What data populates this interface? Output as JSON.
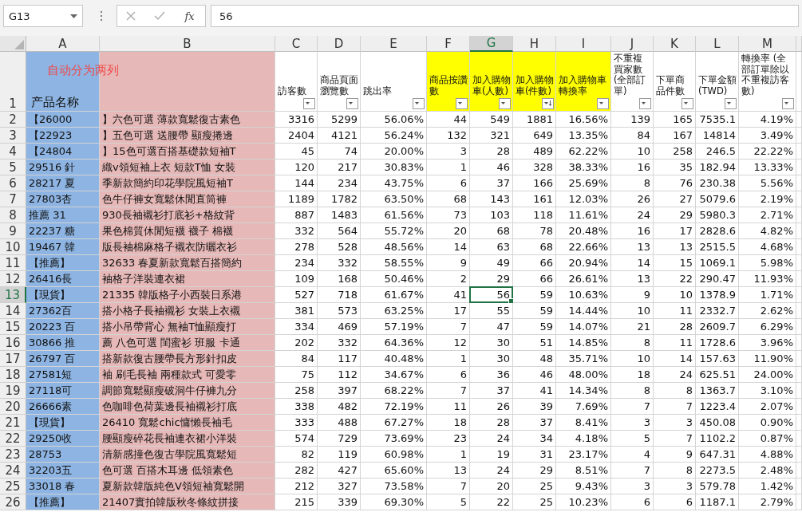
{
  "name_box": "G13",
  "formula_bar": {
    "function_label": "fx",
    "value": "56"
  },
  "header_row": "1",
  "columns": [
    {
      "letter": "A",
      "kind": "product",
      "selected": false,
      "color": "#8db4e2",
      "title": "产品名称",
      "note": "自动分为两列"
    },
    {
      "letter": "B",
      "kind": "product",
      "selected": false,
      "color": "#e6b8b7"
    },
    {
      "letter": "C",
      "kind": "metric",
      "selected": false,
      "title": "訪客數",
      "sorted": false
    },
    {
      "letter": "D",
      "kind": "metric",
      "selected": false,
      "title": "商品頁面瀏覽數",
      "sorted": false
    },
    {
      "letter": "E",
      "kind": "metric",
      "selected": false,
      "title": "跳出率",
      "sorted": false
    },
    {
      "letter": "F",
      "kind": "metric",
      "selected": false,
      "color": "#ffff00",
      "title": "商品按讚數",
      "sorted": false
    },
    {
      "letter": "G",
      "kind": "metric",
      "selected": true,
      "color": "#ffff00",
      "title": "加入購物車(人數)",
      "sorted": false
    },
    {
      "letter": "H",
      "kind": "metric",
      "selected": false,
      "color": "#ffff00",
      "title": "加入購物車(件數)",
      "sorted": true
    },
    {
      "letter": "I",
      "kind": "metric",
      "selected": false,
      "color": "#ffff00",
      "title": "加入購物車轉換率",
      "sorted": false
    },
    {
      "letter": "J",
      "kind": "metric",
      "selected": false,
      "title": "不重複買家數(全部訂單)",
      "sorted": false
    },
    {
      "letter": "K",
      "kind": "metric",
      "selected": false,
      "title": "下單商品件數",
      "sorted": false
    },
    {
      "letter": "L",
      "kind": "metric",
      "selected": false,
      "title": "下單金額(TWD)",
      "sorted": false
    },
    {
      "letter": "M",
      "kind": "metric",
      "selected": false,
      "title": "轉換率 (全部訂單除以不重複訪客數)",
      "sorted": false
    }
  ],
  "rows": [
    {
      "number": "2",
      "selected": false,
      "a": "【26000",
      "b": "】六色可選 薄款寬鬆復古素色",
      "values": [
        "3316",
        "5299",
        "56.06%",
        "44",
        "549",
        "1881",
        "16.56%",
        "139",
        "165",
        "7535.1",
        "4.19%"
      ]
    },
    {
      "number": "3",
      "selected": false,
      "a": "【22923",
      "b": "】五色可選 送腰帶 顯瘦捲邊",
      "values": [
        "2404",
        "4121",
        "56.24%",
        "132",
        "321",
        "649",
        "13.35%",
        "84",
        "167",
        "14814",
        "3.49%"
      ]
    },
    {
      "number": "4",
      "selected": false,
      "a": "【24804",
      "b": "】15色可選百搭基礎款短袖T",
      "values": [
        "45",
        "74",
        "20.00%",
        "3",
        "28",
        "489",
        "62.22%",
        "10",
        "258",
        "246.5",
        "22.22%"
      ]
    },
    {
      "number": "5",
      "selected": false,
      "a": "29516 針",
      "b": "織v領短袖上衣 短款T恤 女裝",
      "values": [
        "120",
        "217",
        "30.83%",
        "1",
        "46",
        "328",
        "38.33%",
        "16",
        "35",
        "182.94",
        "13.33%"
      ]
    },
    {
      "number": "6",
      "selected": false,
      "a": "28217 夏",
      "b": "季新款簡約印花學院風短袖T",
      "values": [
        "144",
        "234",
        "43.75%",
        "6",
        "37",
        "166",
        "25.69%",
        "8",
        "76",
        "230.38",
        "5.56%"
      ]
    },
    {
      "number": "7",
      "selected": false,
      "a": "27803杏",
      "b": "色牛仔褲女寬鬆休閒直筒褲",
      "values": [
        "1189",
        "1782",
        "63.50%",
        "68",
        "143",
        "161",
        "12.03%",
        "26",
        "27",
        "5079.6",
        "2.19%"
      ]
    },
    {
      "number": "8",
      "selected": false,
      "a": "推薦 31",
      "b": "930長袖襯衫打底衫+格紋背",
      "values": [
        "887",
        "1483",
        "61.56%",
        "73",
        "103",
        "118",
        "11.61%",
        "24",
        "29",
        "5980.3",
        "2.71%"
      ]
    },
    {
      "number": "9",
      "selected": false,
      "a": "22237 糖",
      "b": "果色棉質休閒短襪 襪子 棉襪",
      "values": [
        "332",
        "564",
        "55.72%",
        "20",
        "68",
        "78",
        "20.48%",
        "16",
        "17",
        "2828.6",
        "4.82%"
      ]
    },
    {
      "number": "10",
      "selected": false,
      "a": "19467 韓",
      "b": "版長袖棉麻格子襯衣防曬衣衫",
      "values": [
        "278",
        "528",
        "48.56%",
        "14",
        "63",
        "68",
        "22.66%",
        "13",
        "13",
        "2515.5",
        "4.68%"
      ]
    },
    {
      "number": "11",
      "selected": false,
      "a": "【推薦】",
      "b": "32633 春夏新款寬鬆百搭簡約",
      "values": [
        "234",
        "332",
        "58.55%",
        "9",
        "49",
        "66",
        "20.94%",
        "14",
        "15",
        "1069.1",
        "5.98%"
      ]
    },
    {
      "number": "12",
      "selected": false,
      "a": "26416長",
      "b": "袖格子洋裝連衣裙",
      "values": [
        "109",
        "168",
        "50.46%",
        "2",
        "29",
        "66",
        "26.61%",
        "13",
        "22",
        "290.47",
        "11.93%"
      ]
    },
    {
      "number": "13",
      "selected": true,
      "a": "【現貨】",
      "b": "21335 韓版格子小西裝日系港",
      "values": [
        "527",
        "718",
        "61.67%",
        "41",
        "56",
        "59",
        "10.63%",
        "9",
        "10",
        "1378.9",
        "1.71%"
      ]
    },
    {
      "number": "14",
      "selected": false,
      "a": "27362百",
      "b": "搭小格子長袖襯衫 女裝上衣襯",
      "values": [
        "381",
        "573",
        "63.25%",
        "17",
        "55",
        "59",
        "14.44%",
        "10",
        "11",
        "2332.7",
        "2.62%"
      ]
    },
    {
      "number": "15",
      "selected": false,
      "a": "20223 百",
      "b": "搭小吊帶背心 無袖T恤顯瘦打",
      "values": [
        "334",
        "469",
        "57.19%",
        "7",
        "47",
        "59",
        "14.07%",
        "21",
        "28",
        "2609.7",
        "6.29%"
      ]
    },
    {
      "number": "16",
      "selected": false,
      "a": "30866 推",
      "b": "薦 八色可選 閨蜜衫 班服 卡通",
      "values": [
        "202",
        "332",
        "64.36%",
        "12",
        "30",
        "51",
        "14.85%",
        "8",
        "11",
        "1728.6",
        "3.96%"
      ]
    },
    {
      "number": "17",
      "selected": false,
      "a": "26797 百",
      "b": "搭新款復古腰帶長方形針扣皮",
      "values": [
        "84",
        "117",
        "40.48%",
        "1",
        "30",
        "48",
        "35.71%",
        "10",
        "14",
        "157.63",
        "11.90%"
      ]
    },
    {
      "number": "18",
      "selected": false,
      "a": "27581短",
      "b": "袖  刷毛長袖 兩種款式 可愛零",
      "values": [
        "75",
        "112",
        "34.67%",
        "6",
        "36",
        "46",
        "48.00%",
        "18",
        "24",
        "625.51",
        "24.00%"
      ]
    },
    {
      "number": "19",
      "selected": false,
      "a": "27118可",
      "b": "調節寬鬆顯瘦破洞牛仔褲九分",
      "values": [
        "258",
        "397",
        "68.22%",
        "7",
        "37",
        "41",
        "14.34%",
        "8",
        "8",
        "1363.7",
        "3.10%"
      ]
    },
    {
      "number": "20",
      "selected": false,
      "a": "26666素",
      "b": "色咖啡色荷葉邊長袖襯衫打底",
      "values": [
        "338",
        "482",
        "72.19%",
        "11",
        "26",
        "39",
        "7.69%",
        "7",
        "7",
        "1223.4",
        "2.07%"
      ]
    },
    {
      "number": "21",
      "selected": false,
      "a": "【現貨】",
      "b": "26410  寬鬆chic慵懶長袖毛",
      "values": [
        "333",
        "488",
        "67.27%",
        "18",
        "28",
        "37",
        "8.41%",
        "3",
        "3",
        "450.08",
        "0.90%"
      ]
    },
    {
      "number": "22",
      "selected": false,
      "a": "29250收",
      "b": "腰顯瘦碎花長袖連衣裙小洋裝",
      "values": [
        "574",
        "729",
        "73.69%",
        "23",
        "24",
        "34",
        "4.18%",
        "5",
        "7",
        "1102.2",
        "0.87%"
      ]
    },
    {
      "number": "23",
      "selected": false,
      "a": "28753",
      "b": "清新感撞色復古學院風寬鬆短",
      "values": [
        "82",
        "119",
        "60.98%",
        "1",
        "19",
        "31",
        "23.17%",
        "4",
        "9",
        "647.31",
        "4.88%"
      ]
    },
    {
      "number": "24",
      "selected": false,
      "a": "32203五",
      "b": "色可選 百搭木耳邊 低領素色",
      "values": [
        "282",
        "427",
        "65.60%",
        "13",
        "24",
        "29",
        "8.51%",
        "7",
        "8",
        "2273.5",
        "2.48%"
      ]
    },
    {
      "number": "25",
      "selected": false,
      "a": "33018 春",
      "b": "夏新款韓版純色V領短袖寬鬆開",
      "values": [
        "212",
        "327",
        "73.58%",
        "7",
        "20",
        "25",
        "9.43%",
        "3",
        "3",
        "579.78",
        "1.42%"
      ]
    },
    {
      "number": "26",
      "selected": false,
      "a": "【推薦】",
      "b": "21407實拍韓版秋冬條紋拼接",
      "values": [
        "215",
        "339",
        "69.30%",
        "5",
        "22",
        "25",
        "10.23%",
        "6",
        "6",
        "1187.1",
        "2.79%"
      ]
    }
  ]
}
